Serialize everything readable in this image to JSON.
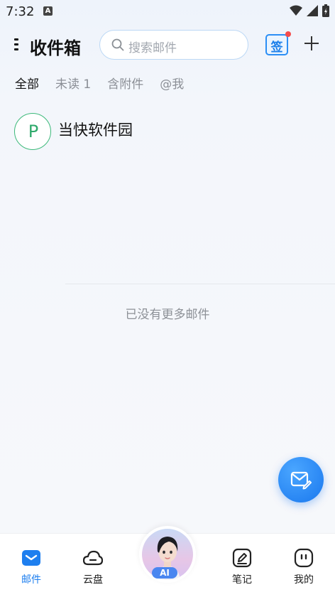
{
  "status_bar": {
    "time": "7:32",
    "notification_badge": "A"
  },
  "header": {
    "title": "收件箱",
    "search_placeholder": "搜索邮件",
    "sign_label": "签"
  },
  "tabs": [
    {
      "label": "全部",
      "active": true
    },
    {
      "label": "未读 1",
      "active": false
    },
    {
      "label": "含附件",
      "active": false
    },
    {
      "label": "@我",
      "active": false
    }
  ],
  "mail_list": [
    {
      "avatar_letter": "P",
      "sender": "当快软件园"
    }
  ],
  "list_end_text": "已没有更多邮件",
  "bottom_nav": {
    "items": [
      {
        "label": "邮件",
        "icon": "mail-icon",
        "active": true
      },
      {
        "label": "云盘",
        "icon": "cloud-icon",
        "active": false
      },
      {
        "label": "笔记",
        "icon": "note-icon",
        "active": false
      },
      {
        "label": "我的",
        "icon": "profile-icon",
        "active": false
      }
    ],
    "ai_label": "AI"
  },
  "colors": {
    "accent": "#1e7fef",
    "avatar_green": "#2faa6c",
    "badge_red": "#f44b4b"
  }
}
